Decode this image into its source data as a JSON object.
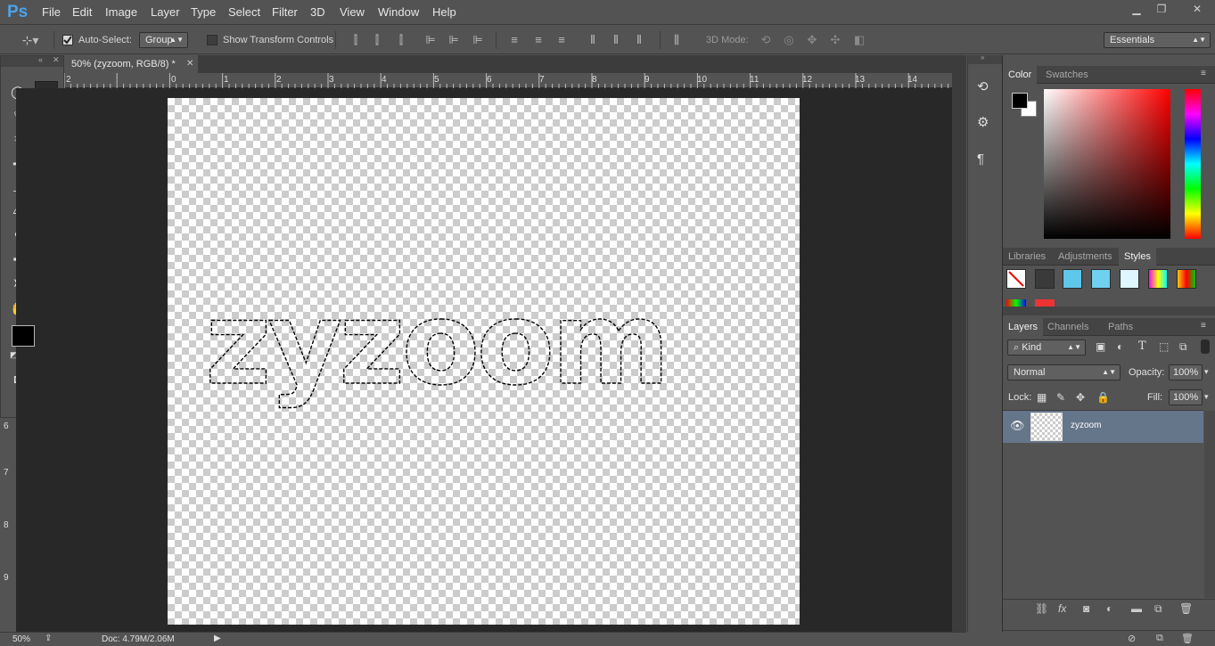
{
  "app": {
    "logo": "Ps"
  },
  "menu": [
    "File",
    "Edit",
    "Image",
    "Layer",
    "Type",
    "Select",
    "Filter",
    "3D",
    "View",
    "Window",
    "Help"
  ],
  "window_controls": {
    "minimize": "▁",
    "restore": "❐",
    "close": "✕"
  },
  "options": {
    "auto_select_label": "Auto-Select:",
    "auto_select_value": "Group",
    "show_transform_label": "Show Transform Controls",
    "mode_3d_label": "3D Mode:",
    "workspace": "Essentials"
  },
  "document": {
    "tab_title": "50% (zyzoom, RGB/8) *",
    "text": "zyzoom"
  },
  "ruler": {
    "h_ticks": [
      "2",
      "0",
      "1",
      "2",
      "3",
      "4",
      "5",
      "6",
      "7",
      "8",
      "9",
      "10",
      "11",
      "12",
      "13",
      "14"
    ],
    "v_ticks": [
      "6",
      "7",
      "8",
      "9"
    ]
  },
  "status": {
    "zoom": "50%",
    "doc": "Doc: 4.79M/2.06M"
  },
  "color_panel": {
    "tabs": [
      "Color",
      "Swatches"
    ],
    "foreground": "#000000",
    "background": "#ffffff"
  },
  "styles_panel": {
    "tabs": [
      "Libraries",
      "Adjustments",
      "Styles"
    ]
  },
  "layers_panel": {
    "tabs": [
      "Layers",
      "Channels",
      "Paths"
    ],
    "filter": "Kind",
    "blend_mode": "Normal",
    "opacity_label": "Opacity:",
    "opacity_value": "100%",
    "lock_label": "Lock:",
    "fill_label": "Fill:",
    "fill_value": "100%",
    "layers": [
      {
        "name": "zyzoom"
      }
    ]
  },
  "colors": {
    "accent": "#4aa3ea",
    "selected_layer": "#65758a",
    "ui_bg": "#535353",
    "pasteboard": "#282828"
  }
}
